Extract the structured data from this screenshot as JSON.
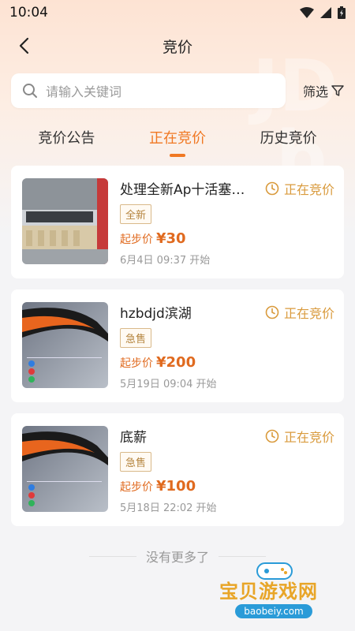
{
  "status_bar": {
    "time": "10:04"
  },
  "nav": {
    "title": "竞价"
  },
  "search": {
    "placeholder": "请输入关键词",
    "filter_label": "筛选"
  },
  "tabs": [
    {
      "label": "竞价公告",
      "active": false
    },
    {
      "label": "正在竞价",
      "active": true
    },
    {
      "label": "历史竞价",
      "active": false
    }
  ],
  "items": [
    {
      "title": "处理全新Ap十活塞卡...",
      "status": "正在竞价",
      "tag": "全新",
      "price_label": "起步价",
      "price": "¥30",
      "start_time": "6月4日 09:37 开始",
      "thumb": "warehouse-photo"
    },
    {
      "title": "hzbdjd滨湖",
      "status": "正在竞价",
      "tag": "急售",
      "price_label": "起步价",
      "price": "¥200",
      "start_time": "5月19日 09:04 开始",
      "thumb": "phone-screenshot"
    },
    {
      "title": "底薪",
      "status": "正在竞价",
      "tag": "急售",
      "price_label": "起步价",
      "price": "¥100",
      "start_time": "5月18日 22:02 开始",
      "thumb": "phone-screenshot"
    }
  ],
  "footer": {
    "no_more": "没有更多了"
  },
  "logo": {
    "name": "宝贝游戏网",
    "url": "baobeiy.com"
  },
  "colors": {
    "accent": "#f07823",
    "status": "#d99a3c",
    "price": "#e06a1f"
  }
}
